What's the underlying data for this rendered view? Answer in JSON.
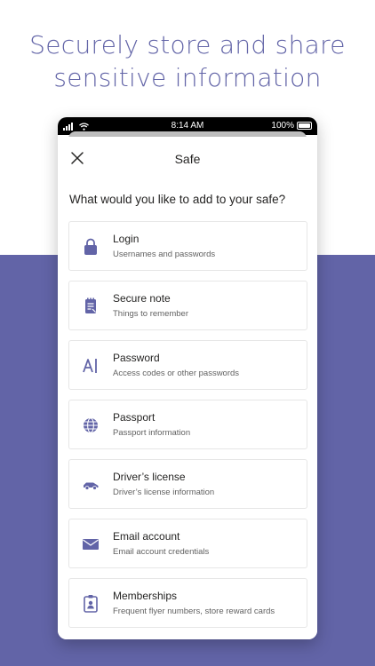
{
  "headline": {
    "line1": "Securely store and share",
    "line2": "sensitive information"
  },
  "status_bar": {
    "time": "8:14 AM",
    "battery": "100%"
  },
  "nav": {
    "title": "Safe",
    "close_icon": "close-icon"
  },
  "prompt": "What would you like to add to your safe?",
  "items": [
    {
      "title": "Login",
      "subtitle": "Usernames and passwords",
      "icon": "lock-icon"
    },
    {
      "title": "Secure note",
      "subtitle": "Things to remember",
      "icon": "note-icon"
    },
    {
      "title": "Password",
      "subtitle": "Access codes or other passwords",
      "icon": "password-icon"
    },
    {
      "title": "Passport",
      "subtitle": "Passport information",
      "icon": "globe-icon"
    },
    {
      "title": "Driver’s license",
      "subtitle": "Driver’s license information",
      "icon": "car-icon"
    },
    {
      "title": "Email account",
      "subtitle": "Email account credentials",
      "icon": "envelope-icon"
    },
    {
      "title": "Memberships",
      "subtitle": "Frequent flyer numbers, store reward cards",
      "icon": "badge-icon"
    }
  ],
  "colors": {
    "accent": "#6264a7",
    "text": "#252423",
    "subtext": "#616161"
  }
}
